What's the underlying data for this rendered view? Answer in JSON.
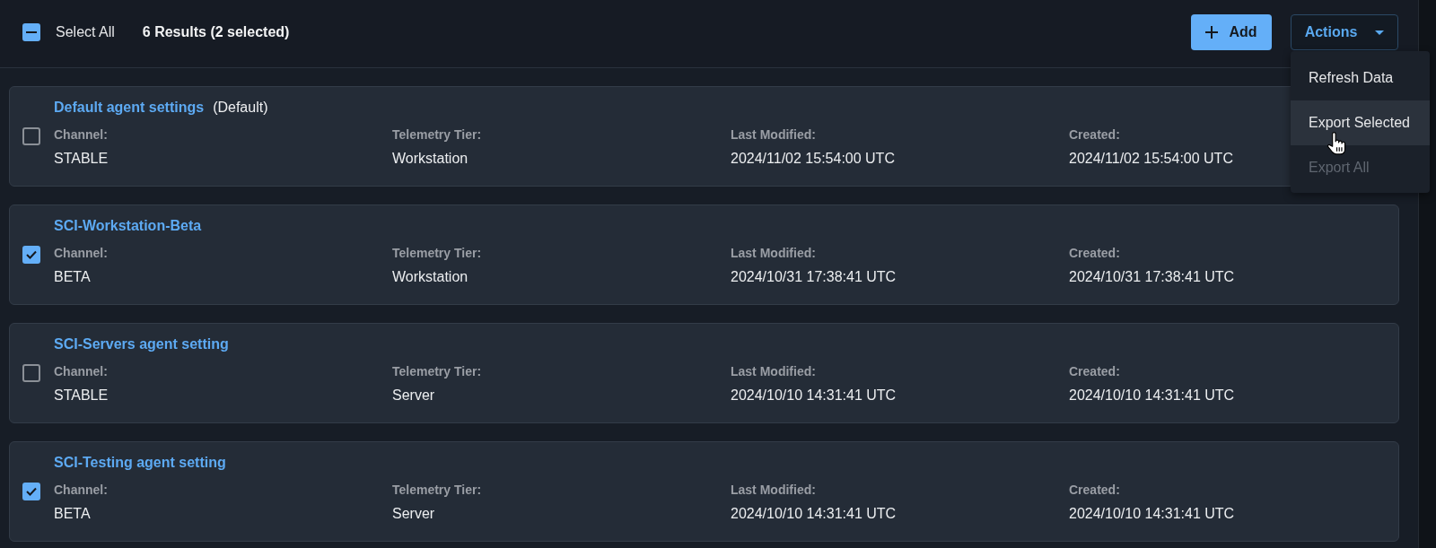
{
  "toolbar": {
    "select_all": {
      "label": "Select All",
      "indeterminate": true
    },
    "result_count": "6 Results (2 selected)",
    "add_button": {
      "label": "Add"
    },
    "actions_button": {
      "label": "Actions",
      "expanded": true
    }
  },
  "actions_menu": [
    {
      "label": "Refresh Data",
      "highlighted": false,
      "disabled": false
    },
    {
      "label": "Export Selected",
      "highlighted": true,
      "disabled": false
    },
    {
      "label": "Export All",
      "highlighted": false,
      "disabled": true
    }
  ],
  "cards": [
    {
      "title": "Default agent settings",
      "badge": "(Default)",
      "selected": false,
      "fields": [
        {
          "label": "Channel:",
          "value": "STABLE"
        },
        {
          "label": "Telemetry Tier:",
          "value": "Workstation"
        },
        {
          "label": "Last Modified:",
          "value": "2024/11/02 15:54:00 UTC"
        },
        {
          "label": "Created:",
          "value": "2024/11/02 15:54:00 UTC"
        }
      ]
    },
    {
      "title": "SCI-Workstation-Beta",
      "selected": true,
      "fields": [
        {
          "label": "Channel:",
          "value": "BETA"
        },
        {
          "label": "Telemetry Tier:",
          "value": "Workstation"
        },
        {
          "label": "Last Modified:",
          "value": "2024/10/31 17:38:41 UTC"
        },
        {
          "label": "Created:",
          "value": "2024/10/31 17:38:41 UTC"
        }
      ]
    },
    {
      "title": "SCI-Servers agent setting",
      "selected": false,
      "fields": [
        {
          "label": "Channel:",
          "value": "STABLE"
        },
        {
          "label": "Telemetry Tier:",
          "value": "Server"
        },
        {
          "label": "Last Modified:",
          "value": "2024/10/10 14:31:41 UTC"
        },
        {
          "label": "Created:",
          "value": "2024/10/10 14:31:41 UTC"
        }
      ]
    },
    {
      "title": "SCI-Testing agent setting",
      "selected": true,
      "fields": [
        {
          "label": "Channel:",
          "value": "BETA"
        },
        {
          "label": "Telemetry Tier:",
          "value": "Server"
        },
        {
          "label": "Last Modified:",
          "value": "2024/10/10 14:31:41 UTC"
        },
        {
          "label": "Created:",
          "value": "2024/10/10 14:31:41 UTC"
        }
      ]
    }
  ]
}
